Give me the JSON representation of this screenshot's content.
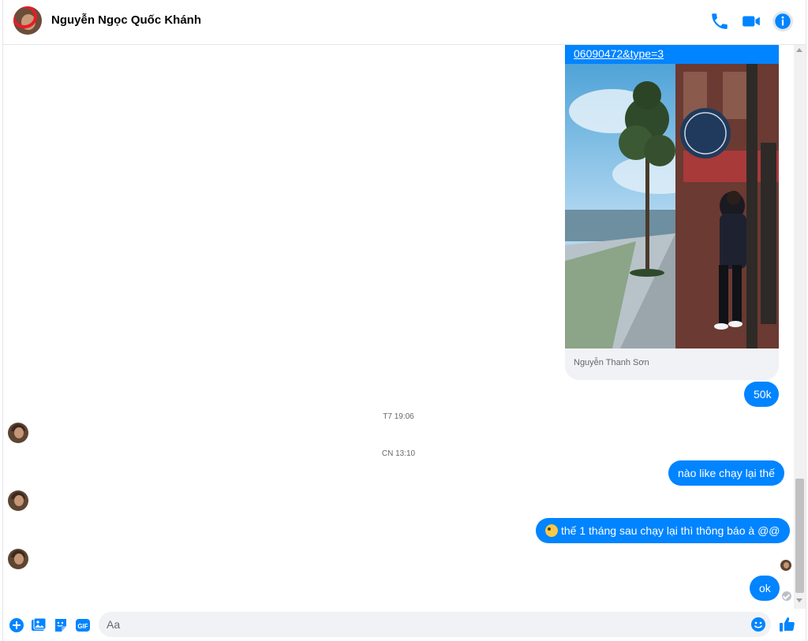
{
  "header": {
    "contact_name": "Nguyễn Ngọc Quốc Khánh",
    "icons": [
      "phone-icon",
      "video-camera-icon",
      "info-icon"
    ]
  },
  "shared_card": {
    "link_text": "06090472&type=3",
    "caption": "Nguyễn Thanh Sơn"
  },
  "messages": {
    "msg_50k": "50k",
    "timestamp_1": "T7 19:06",
    "timestamp_2": "CN 13:10",
    "msg_like_chay": "nào like chạy lại thế",
    "msg_thong_bao": "thế 1 tháng sau chạy lại thì thông báo à @@",
    "msg_ok": "ok"
  },
  "composer": {
    "placeholder": "Aa",
    "icons": [
      "plus-icon",
      "photo-icon",
      "sticker-icon",
      "gif-icon",
      "emoji-icon",
      "thumbs-up-icon"
    ],
    "gif_label": "GIF"
  },
  "colors": {
    "accent": "#0084ff",
    "messenger_blue": "#0a7cff",
    "input_bg": "#f0f2f5",
    "text": "#050505",
    "secondary_text": "#65676b"
  }
}
